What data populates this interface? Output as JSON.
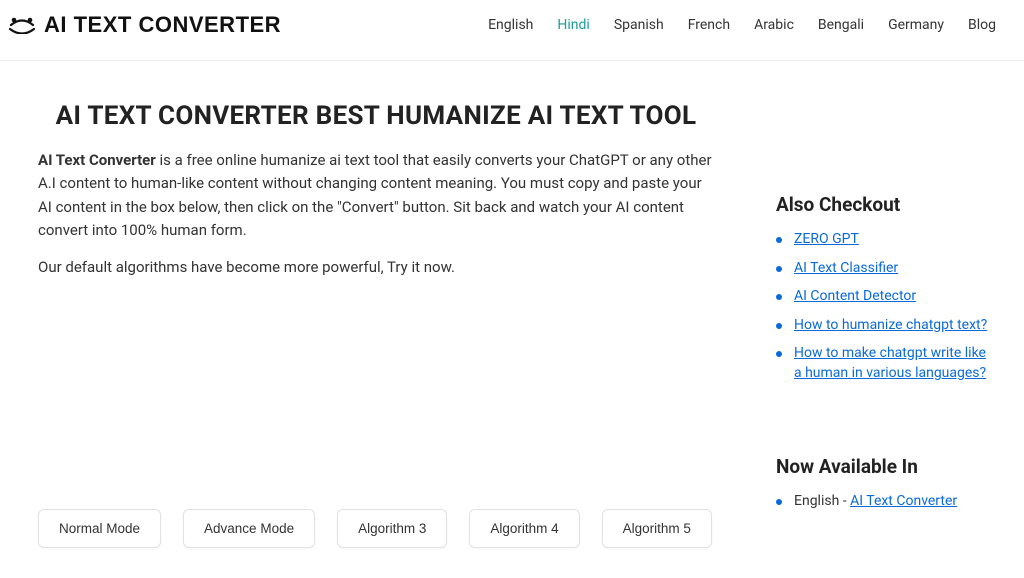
{
  "header": {
    "logo_text": "AI TEXT CONVERTER",
    "nav": [
      {
        "label": "English",
        "active": false
      },
      {
        "label": "Hindi",
        "active": true
      },
      {
        "label": "Spanish",
        "active": false
      },
      {
        "label": "French",
        "active": false
      },
      {
        "label": "Arabic",
        "active": false
      },
      {
        "label": "Bengali",
        "active": false
      },
      {
        "label": "Germany",
        "active": false
      },
      {
        "label": "Blog",
        "active": false
      }
    ]
  },
  "main": {
    "title": "AI TEXT CONVERTER BEST HUMANIZE AI TEXT TOOL",
    "intro_bold": "AI Text Converter",
    "intro_rest": " is a free online humanize ai text tool that easily converts your ChatGPT or any other A.I content to human-like content without changing content meaning. You must copy and paste your AI content in the box below, then click on the \"Convert\" button. Sit back and watch your AI content convert into 100% human form.",
    "intro_p2": "Our default algorithms have become more powerful, Try it now.",
    "modes": [
      "Normal Mode",
      "Advance Mode",
      "Algorithm 3",
      "Algorithm 4",
      "Algorithm 5"
    ]
  },
  "sidebar": {
    "checkout_title": "Also Checkout",
    "checkout_links": [
      "ZERO GPT",
      "AI Text Classifier",
      "AI Content Detector",
      "How to humanize chatgpt text?",
      "How to make chatgpt write like a human in various languages?"
    ],
    "available_title": "Now Available In",
    "available_items": [
      {
        "lang": "English",
        "link": "AI Text Converter"
      }
    ]
  }
}
